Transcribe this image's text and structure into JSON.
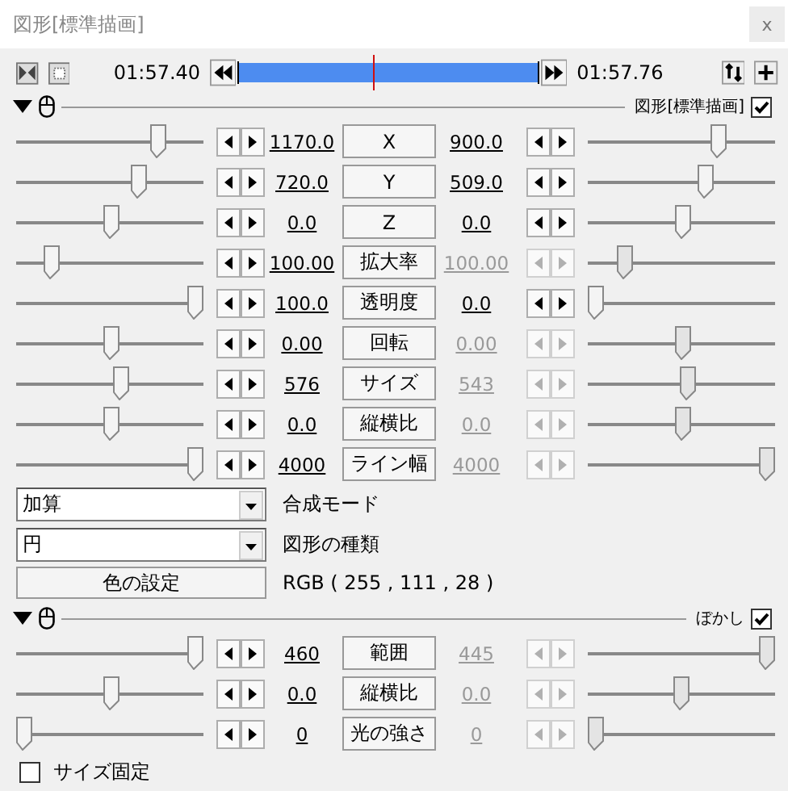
{
  "window": {
    "title": "図形[標準描画]",
    "close": "x"
  },
  "timeline": {
    "start": "01:57.40",
    "end": "01:57.76",
    "level": 0.45
  },
  "object_section": {
    "label": "図形[標準描画]",
    "checked": true,
    "rows": [
      {
        "label": "X",
        "start": "1170.0",
        "end": "900.0",
        "start_slider": {
          "level": 0.78
        },
        "end_slider": {
          "level": 0.72
        },
        "end_disabled": false
      },
      {
        "label": "Y",
        "start": "720.0",
        "end": "509.0",
        "start_slider": {
          "level": 0.67
        },
        "end_slider": {
          "level": 0.64
        },
        "end_disabled": false
      },
      {
        "label": "Z",
        "start": "0.0",
        "end": "0.0",
        "start_slider": {
          "level": 0.51
        },
        "end_slider": {
          "level": 0.51
        },
        "end_disabled": false
      },
      {
        "label": "拡大率",
        "start": "100.00",
        "end": "100.00",
        "start_slider": {
          "level": 0.16
        },
        "end_slider": {
          "level": 0.17
        },
        "end_disabled": true
      },
      {
        "label": "透明度",
        "start": "100.0",
        "end": "0.0",
        "start_slider": {
          "level": 1.0
        },
        "end_slider": {
          "level": 0.0
        },
        "end_disabled": false
      },
      {
        "label": "回転",
        "start": "0.00",
        "end": "0.00",
        "start_slider": {
          "level": 0.51
        },
        "end_slider": {
          "level": 0.51
        },
        "end_disabled": true
      },
      {
        "label": "サイズ",
        "start": "576",
        "end": "543",
        "start_slider": {
          "level": 0.57
        },
        "end_slider": {
          "level": 0.54
        },
        "end_disabled": true
      },
      {
        "label": "縦横比",
        "start": "0.0",
        "end": "0.0",
        "start_slider": {
          "level": 0.51
        },
        "end_slider": {
          "level": 0.51
        },
        "end_disabled": true
      },
      {
        "label": "ライン幅",
        "start": "4000",
        "end": "4000",
        "start_slider": {
          "level": 1.0
        },
        "end_slider": {
          "level": 1.0
        },
        "end_disabled": true
      }
    ],
    "blend_mode": {
      "value": "加算",
      "label": "合成モード"
    },
    "shape_type": {
      "value": "円",
      "label": "図形の種類"
    },
    "color_button": "色の設定",
    "color_value": "RGB ( 255 , 111 , 28 )"
  },
  "blur_section": {
    "label": "ぼかし",
    "checked": true,
    "rows": [
      {
        "label": "範囲",
        "start": "460",
        "end": "445",
        "start_slider": {
          "level": 1.0
        },
        "end_slider": {
          "level": 1.0
        },
        "end_disabled": true
      },
      {
        "label": "縦横比",
        "start": "0.0",
        "end": "0.0",
        "start_slider": {
          "level": 0.51
        },
        "end_slider": {
          "level": 0.5
        },
        "end_disabled": true
      },
      {
        "label": "光の強さ",
        "start": "0",
        "end": "0",
        "start_slider": {
          "level": 0.0
        },
        "end_slider": {
          "level": 0.0
        },
        "end_disabled": true
      }
    ],
    "fixed_size": {
      "label": "サイズ固定",
      "checked": false
    }
  }
}
